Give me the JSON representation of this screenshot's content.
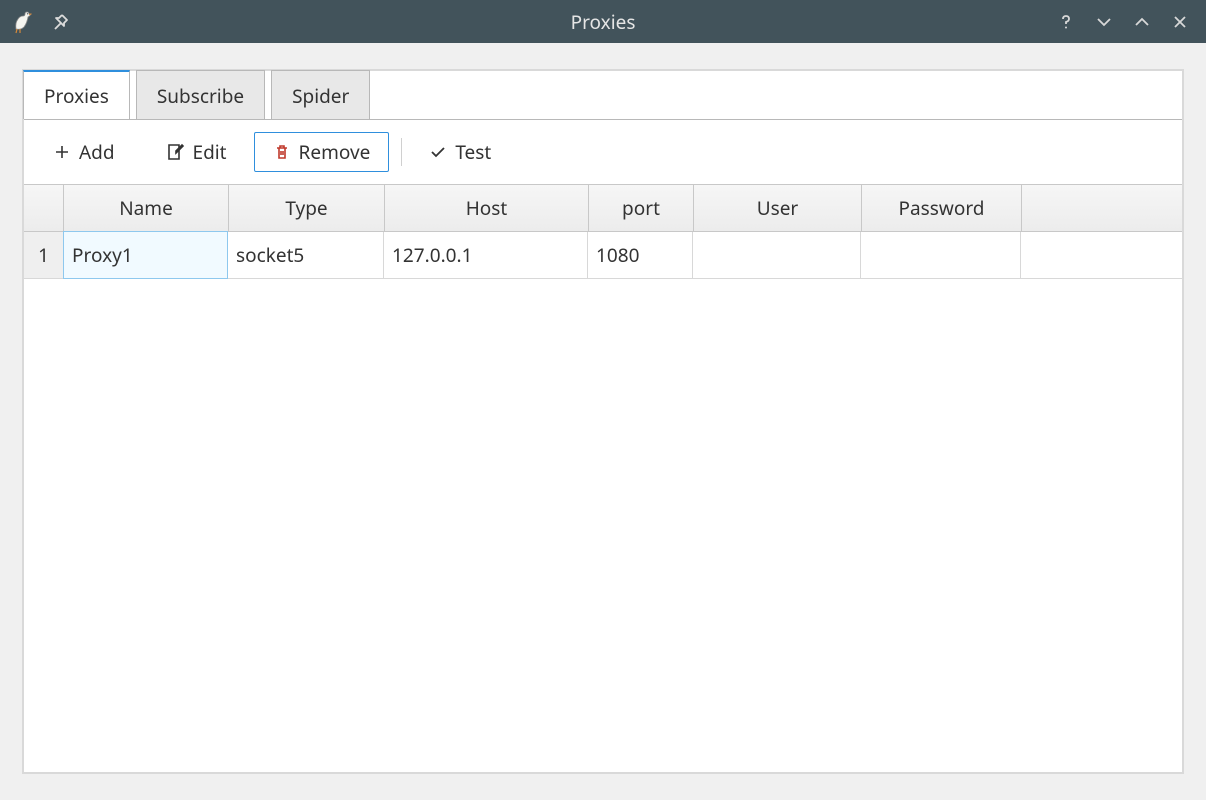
{
  "window": {
    "title": "Proxies"
  },
  "tabs": {
    "items": [
      {
        "label": "Proxies",
        "active": true
      },
      {
        "label": "Subscribe",
        "active": false
      },
      {
        "label": "Spider",
        "active": false
      }
    ]
  },
  "toolbar": {
    "add_label": "Add",
    "edit_label": "Edit",
    "remove_label": "Remove",
    "test_label": "Test"
  },
  "table": {
    "headers": {
      "name": "Name",
      "type": "Type",
      "host": "Host",
      "port": "port",
      "user": "User",
      "password": "Password"
    },
    "rows": [
      {
        "index": "1",
        "name": "Proxy1",
        "type": "socket5",
        "host": "127.0.0.1",
        "port": "1080",
        "user": "",
        "password": ""
      }
    ]
  }
}
